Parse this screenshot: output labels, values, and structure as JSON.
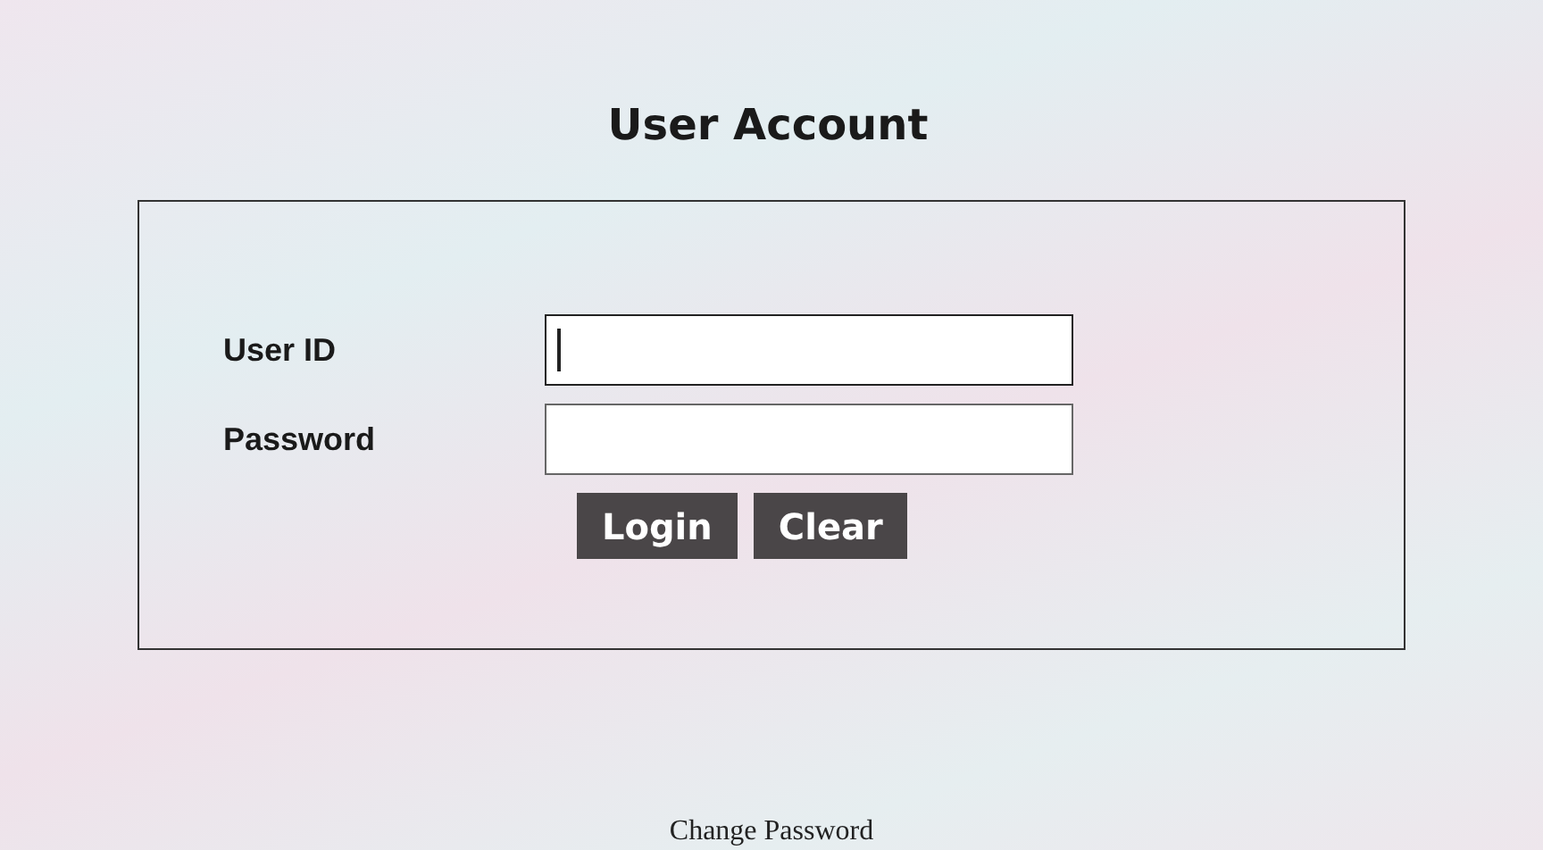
{
  "title": "User Account",
  "fields": [
    {
      "label": "User ID",
      "focused": true
    },
    {
      "label": "Password",
      "focused": false
    }
  ],
  "buttons": [
    "Login",
    "Clear"
  ],
  "link": "Change Password"
}
